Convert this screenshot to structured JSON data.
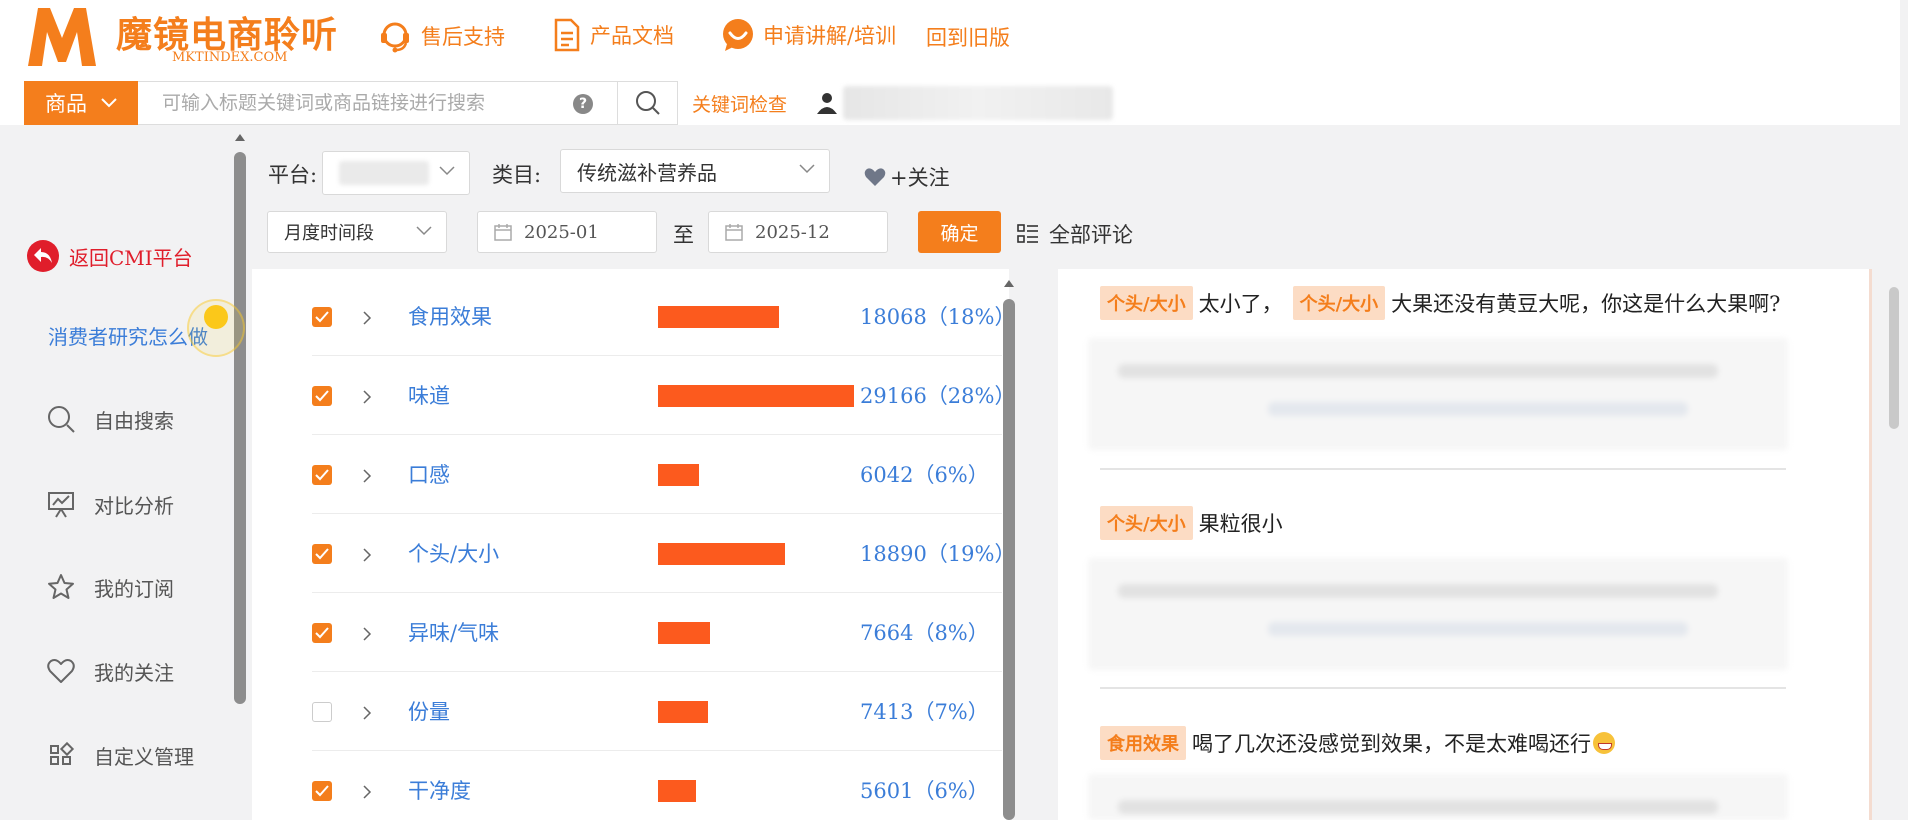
{
  "header": {
    "logo_letter": "M",
    "brand": "魔镜电商聆听",
    "brand_sub": "MKTINDEX.COM",
    "nav": [
      {
        "label": "售后支持",
        "icon": "headset-icon"
      },
      {
        "label": "产品文档",
        "icon": "document-icon"
      },
      {
        "label": "申请讲解/培训",
        "icon": "smile-chat-icon"
      },
      {
        "label": "回到旧版",
        "icon": ""
      }
    ],
    "category_select": "商品",
    "search_placeholder": "可输入标题关键词或商品链接进行搜索",
    "help_symbol": "?",
    "keyword_check": "关键词检查"
  },
  "sidebar": {
    "back_label": "返回CMI平台",
    "consumer_link": "消费者研究怎么做",
    "items": [
      {
        "label": "自由搜索",
        "icon": "search-icon"
      },
      {
        "label": "对比分析",
        "icon": "chart-board-icon"
      },
      {
        "label": "我的订阅",
        "icon": "star-icon"
      },
      {
        "label": "我的关注",
        "icon": "heart-icon"
      },
      {
        "label": "自定义管理",
        "icon": "grid-icon"
      }
    ]
  },
  "filters": {
    "platform_label": "平台:",
    "category_label": "类目:",
    "category_value": "传统滋补营养品",
    "follow_label": "+关注",
    "period_select": "月度时间段",
    "date_start": "2025-01",
    "date_to": "至",
    "date_end": "2025-12",
    "confirm": "确定",
    "all_reviews": "全部评论"
  },
  "aspects": [
    {
      "name": "食用效果",
      "count_text": "18068（18%）",
      "count": 18068,
      "checked": true
    },
    {
      "name": "味道",
      "count_text": "29166（28%）",
      "count": 29166,
      "checked": true
    },
    {
      "name": "口感",
      "count_text": "6042（6%）",
      "count": 6042,
      "checked": true
    },
    {
      "name": "个头/大小",
      "count_text": "18890（19%）",
      "count": 18890,
      "checked": true
    },
    {
      "name": "异味/气味",
      "count_text": "7664（8%）",
      "count": 7664,
      "checked": true
    },
    {
      "name": "份量",
      "count_text": "7413（7%）",
      "count": 7413,
      "checked": false
    },
    {
      "name": "干净度",
      "count_text": "5601（6%）",
      "count": 5601,
      "checked": true
    }
  ],
  "reviews": [
    {
      "tags": [
        "个头/大小",
        "个头/大小"
      ],
      "segments": [
        "太小了，",
        "大果还没有黄豆大呢，你这是什么大果啊?"
      ]
    },
    {
      "tags": [
        "个头/大小"
      ],
      "segments": [
        "果粒很小"
      ]
    },
    {
      "tags": [
        "食用效果"
      ],
      "segments": [
        "喝了几次还没感觉到效果，不是太难喝还行"
      ]
    }
  ],
  "colors": {
    "accent": "#f47e1c",
    "bar": "#fc5a1e",
    "link": "#3b7dd8",
    "back": "#e01e2b"
  }
}
